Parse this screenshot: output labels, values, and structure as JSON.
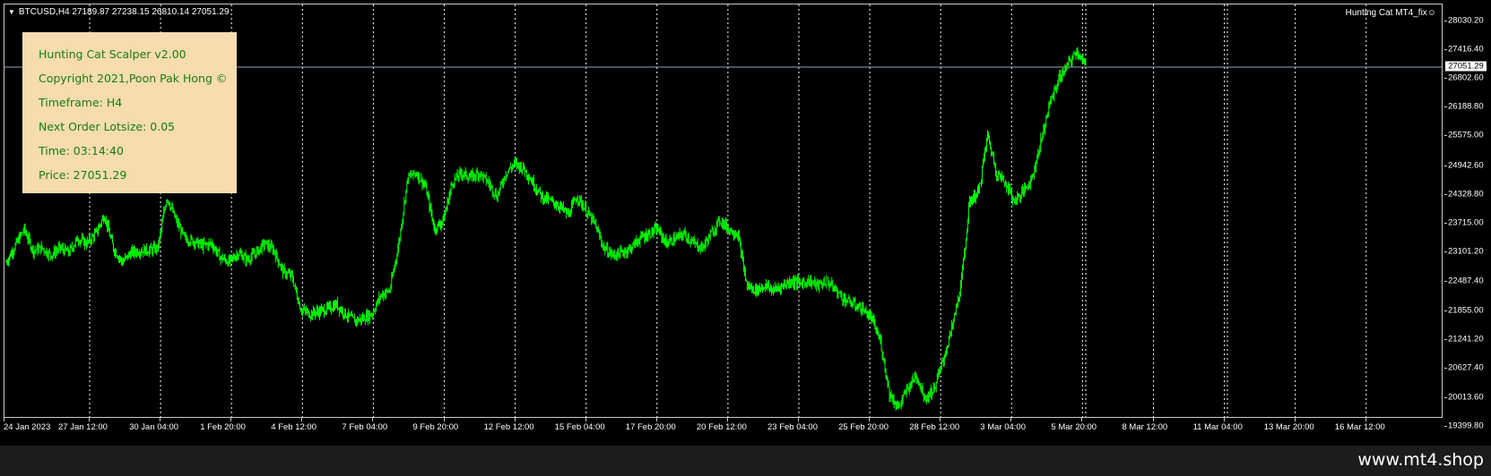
{
  "window": {
    "symbol_info": "BTCUSD,H4  27189.87 27238.15 26810.14 27051.29",
    "ea_name": "Hunting Cat MT4_fix☺"
  },
  "info_panel": {
    "lines": [
      "Hunting Cat Scalper v2.00",
      "Copyright 2021,Poon Pak Hong ©",
      "Timeframe: H4",
      "Next Order Lotsize: 0.05",
      "Time: 03:14:40",
      "Price: 27051.29"
    ]
  },
  "colors": {
    "candle": "#00ff00",
    "panel_bg": "#f6dcaf",
    "panel_text": "#1a7a12",
    "grid": "#ffffff",
    "price_line": "#8fa6bb"
  },
  "watermark": "www.mt4.shop",
  "chart_data": {
    "type": "candlestick",
    "symbol": "BTCUSD",
    "timeframe": "H4",
    "current_price": 27051.29,
    "current_price_label": "27051.29",
    "ohlc_last": {
      "open": 27189.87,
      "high": 27238.15,
      "low": 26810.14,
      "close": 27051.29
    },
    "ylim": [
      19700,
      28250
    ],
    "price_ticks": [
      "28030.20",
      "27416.40",
      "26802.60",
      "26188.80",
      "25575.00",
      "24942.60",
      "24328.80",
      "23715.00",
      "23101.20",
      "22487.40",
      "21855.00",
      "21241.20",
      "20627.40",
      "20013.60",
      "19399.80"
    ],
    "time_labels": [
      "24 Jan 2023",
      "27 Jan 12:00",
      "30 Jan 04:00",
      "1 Feb 20:00",
      "4 Feb 12:00",
      "7 Feb 04:00",
      "9 Feb 20:00",
      "12 Feb 12:00",
      "15 Feb 04:00",
      "17 Feb 20:00",
      "20 Feb 12:00",
      "23 Feb 04:00",
      "25 Feb 20:00",
      "28 Feb 12:00",
      "3 Mar 04:00",
      "5 Mar 20:00",
      "8 Mar 12:00",
      "11 Mar 04:00",
      "13 Mar 20:00",
      "16 Mar 12:00"
    ],
    "closes": [
      22900,
      23250,
      23600,
      23150,
      23200,
      23050,
      23200,
      23100,
      23400,
      23300,
      23500,
      23900,
      23200,
      22900,
      23100,
      23150,
      23150,
      23200,
      24300,
      23800,
      23400,
      23350,
      23250,
      23300,
      23000,
      22900,
      23100,
      22950,
      23100,
      23300,
      23150,
      22700,
      22600,
      21900,
      21800,
      21850,
      21900,
      22000,
      21800,
      21650,
      21700,
      21800,
      22200,
      22300,
      23300,
      24700,
      24800,
      24500,
      23600,
      23800,
      24600,
      24800,
      24700,
      24800,
      24600,
      24300,
      24800,
      25000,
      24900,
      24600,
      24300,
      24200,
      24100,
      23900,
      24300,
      24000,
      23700,
      23200,
      23050,
      23100,
      23200,
      23400,
      23500,
      23600,
      23300,
      23400,
      23500,
      23300,
      23200,
      23500,
      23800,
      23600,
      23500,
      22400,
      22300,
      22400,
      22300,
      22400,
      22500,
      22450,
      22500,
      22400,
      22500,
      22300,
      22100,
      22000,
      21900,
      21700,
      21200,
      20100,
      19800,
      20200,
      20500,
      20000,
      20200,
      20800,
      21500,
      22400,
      24200,
      24400,
      25600,
      24800,
      24600,
      24200,
      24400,
      24700,
      25500,
      26300,
      26800,
      27100,
      27400,
      27051
    ]
  }
}
